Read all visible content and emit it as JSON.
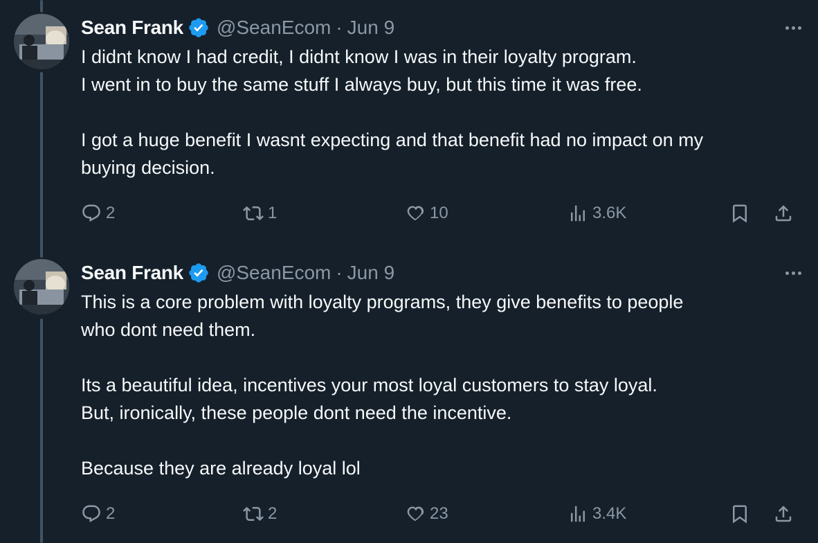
{
  "tweets": [
    {
      "display_name": "Sean Frank",
      "handle": "@SeanEcom",
      "separator": "·",
      "date": "Jun 9",
      "paragraphs": [
        [
          "I didnt know I had credit, I didnt know I was in their loyalty program.",
          "I went in to buy the same stuff I always buy, but this time it was free."
        ],
        [
          "I got a huge benefit I wasnt expecting and that benefit had no impact on my",
          "buying decision."
        ]
      ],
      "replies": "2",
      "reposts": "1",
      "likes": "10",
      "views": "3.6K"
    },
    {
      "display_name": "Sean Frank",
      "handle": "@SeanEcom",
      "separator": "·",
      "date": "Jun 9",
      "paragraphs": [
        [
          "This is a core problem with loyalty programs, they give benefits to people",
          "who dont need them."
        ],
        [
          "Its a beautiful idea, incentives your most loyal customers to stay loyal.",
          "But, ironically, these people dont need the incentive."
        ],
        [
          "Because they are already loyal lol"
        ]
      ],
      "replies": "2",
      "reposts": "2",
      "likes": "23",
      "views": "3.4K"
    }
  ],
  "colors": {
    "background": "#15202b",
    "text": "#f7f9f9",
    "secondary": "#8b98a5",
    "verified": "#1d9bf0",
    "thread_line": "#425364"
  },
  "icons": [
    "verified-badge-icon",
    "more-icon",
    "reply-icon",
    "repost-icon",
    "like-icon",
    "views-icon",
    "bookmark-icon",
    "share-icon"
  ]
}
